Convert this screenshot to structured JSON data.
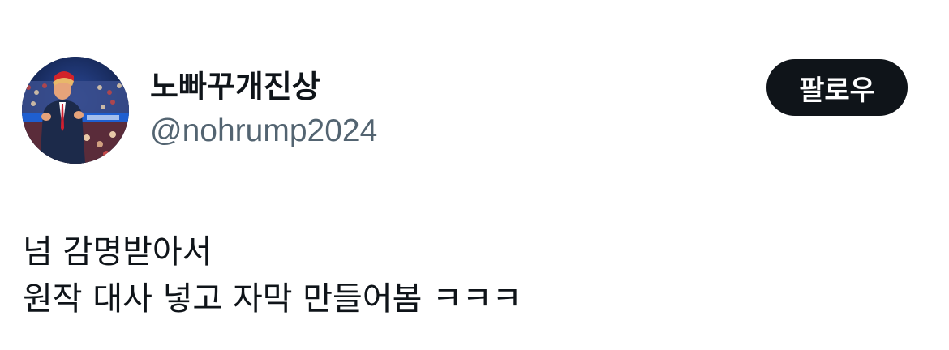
{
  "user": {
    "display_name": "노빠꾸개진상",
    "handle": "@nohrump2024",
    "avatar": "profile-photo"
  },
  "follow_button": {
    "label": "팔로우"
  },
  "tweet": {
    "lines": [
      "넘 감명받아서",
      "원작 대사 넣고 자막 만들어봄 ㅋㅋㅋ"
    ]
  },
  "colors": {
    "text_primary": "#0f1419",
    "text_secondary": "#536471",
    "button_bg": "#0f1419",
    "button_text": "#ffffff",
    "background": "#ffffff"
  }
}
